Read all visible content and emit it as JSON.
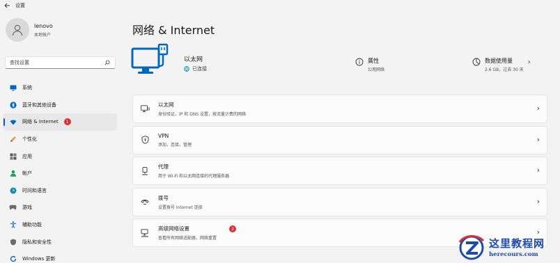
{
  "window": {
    "title": "设置"
  },
  "profile": {
    "name": "lenovo",
    "account_type": "本地帐户"
  },
  "search": {
    "placeholder": "查找设置"
  },
  "sidebar": {
    "items": [
      {
        "label": "系统",
        "icon": "monitor-icon"
      },
      {
        "label": "蓝牙和其他设备",
        "icon": "bluetooth-icon"
      },
      {
        "label": "网络 & Internet",
        "icon": "wifi-icon",
        "active": true,
        "badge": "1"
      },
      {
        "label": "个性化",
        "icon": "pen-icon"
      },
      {
        "label": "应用",
        "icon": "apps-icon"
      },
      {
        "label": "帐户",
        "icon": "person-icon"
      },
      {
        "label": "时间和语言",
        "icon": "globe-clock-icon"
      },
      {
        "label": "游戏",
        "icon": "gamepad-icon"
      },
      {
        "label": "辅助功能",
        "icon": "accessibility-icon"
      },
      {
        "label": "隐私和安全性",
        "icon": "shield-icon"
      },
      {
        "label": "Windows 更新",
        "icon": "update-icon"
      }
    ]
  },
  "main": {
    "title": "网络 & Internet",
    "hero": {
      "name": "以太网",
      "status": "已连接",
      "properties": {
        "title": "属性",
        "subtitle": "公用网络"
      },
      "data_usage": {
        "title": "数据使用量",
        "subtitle": "2.6 GB，过去 30 天"
      }
    },
    "cards": [
      {
        "title": "以太网",
        "desc": "身份验证，IP 和 DNS 设置，按流量计费的网络",
        "icon": "ethernet-icon"
      },
      {
        "title": "VPN",
        "desc": "添加，连接，管理",
        "icon": "vpn-shield-icon"
      },
      {
        "title": "代理",
        "desc": "用于 Wi-Fi 和以太网连接的代理服务器",
        "icon": "proxy-icon"
      },
      {
        "title": "拨号",
        "desc": "设置拨号 Internet 连接",
        "icon": "dialup-icon"
      },
      {
        "title": "高级网络设置",
        "desc": "查看所有网络适配器，网络重置",
        "icon": "advanced-network-icon",
        "badge": "2"
      }
    ]
  },
  "watermark": {
    "cn": "这里教程网",
    "url": "herecours.com"
  },
  "colors": {
    "accent": "#005fb8",
    "badge": "#d93131",
    "hero_icon": "#0067c0",
    "watermark": "#1f4aa8"
  }
}
